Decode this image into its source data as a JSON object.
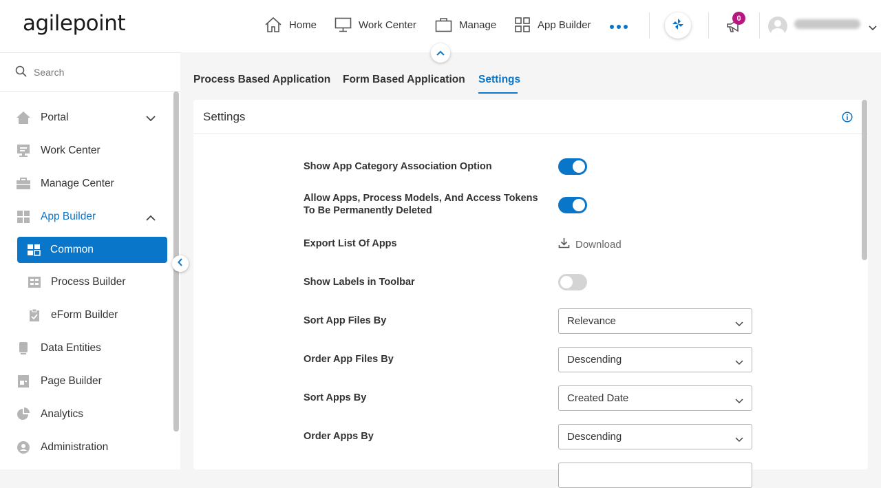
{
  "header": {
    "logo_text": "agilepoint",
    "nav": [
      {
        "label": "Home",
        "icon": "home-icon"
      },
      {
        "label": "Work Center",
        "icon": "monitor-icon"
      },
      {
        "label": "Manage",
        "icon": "briefcase-icon"
      },
      {
        "label": "App Builder",
        "icon": "grid-icon"
      }
    ],
    "more_icon": "more-dots-icon",
    "notification_count": "0",
    "accent_color": "#0a76c9",
    "badge_color": "#b5187e"
  },
  "sidebar": {
    "search_placeholder": "Search",
    "items": [
      {
        "label": "Portal",
        "icon": "home-icon"
      },
      {
        "label": "Work Center",
        "icon": "monitor-icon"
      },
      {
        "label": "Manage Center",
        "icon": "briefcase-icon"
      },
      {
        "label": "App Builder",
        "icon": "grid-icon"
      },
      {
        "label": "Data Entities",
        "icon": "database-icon"
      },
      {
        "label": "Page Builder",
        "icon": "page-icon"
      },
      {
        "label": "Analytics",
        "icon": "pie-chart-icon"
      },
      {
        "label": "Administration",
        "icon": "user-icon"
      }
    ],
    "sub_items": [
      {
        "label": "Common",
        "icon": "common-icon"
      },
      {
        "label": "Process Builder",
        "icon": "process-icon"
      },
      {
        "label": "eForm Builder",
        "icon": "form-icon"
      }
    ]
  },
  "tabs": [
    {
      "label": "Process Based Application"
    },
    {
      "label": "Form Based Application"
    },
    {
      "label": "Settings"
    }
  ],
  "panel": {
    "title": "Settings",
    "settings": [
      {
        "label": "Show App Category Association Option",
        "toggle": "on"
      },
      {
        "label_line1": "Allow Apps, Process Models, And Access Tokens",
        "label_line2": "To Be Permanently Deleted",
        "toggle": "on"
      },
      {
        "label": "Export List Of Apps",
        "action": "Download"
      },
      {
        "label": "Show Labels in Toolbar",
        "toggle": "off"
      },
      {
        "label": "Sort App Files By",
        "value": "Relevance"
      },
      {
        "label": "Order App Files By",
        "value": "Descending"
      },
      {
        "label": "Sort Apps By",
        "value": "Created Date"
      },
      {
        "label": "Order Apps By",
        "value": "Descending"
      }
    ]
  }
}
